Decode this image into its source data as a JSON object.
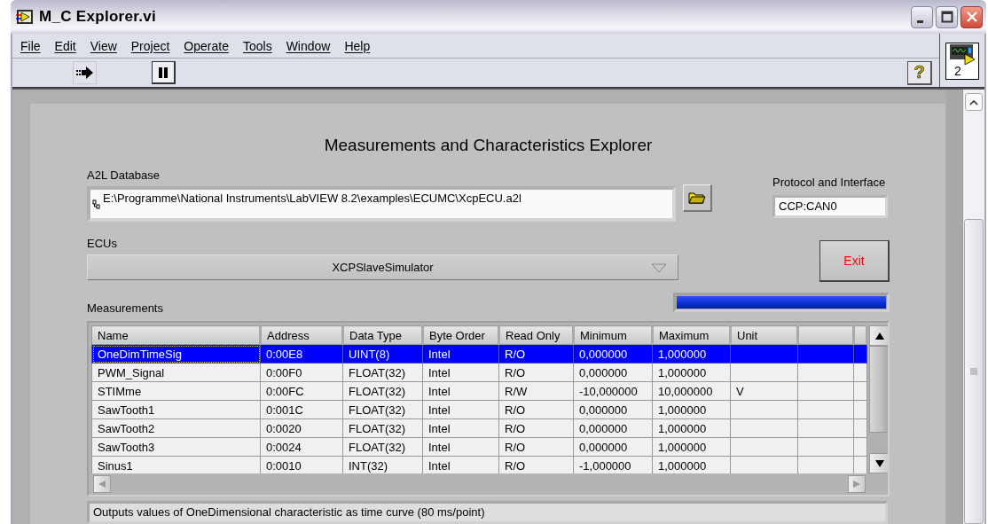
{
  "window": {
    "title": "M_C Explorer.vi"
  },
  "menu": [
    "File",
    "Edit",
    "View",
    "Project",
    "Operate",
    "Tools",
    "Window",
    "Help"
  ],
  "toolbar": {
    "help_button": "?",
    "vi_icon_label": "2"
  },
  "panel": {
    "title": "Measurements and Characteristics Explorer",
    "a2l_database": {
      "label": "A2L Database",
      "value": "E:\\Programme\\National Instruments\\LabVIEW 8.2\\examples\\ECUMC\\XcpECU.a2l"
    },
    "protocol": {
      "label": "Protocol and Interface",
      "value": "CCP:CAN0"
    },
    "ecus": {
      "label": "ECUs",
      "value": "XCPSlaveSimulator"
    },
    "exit_button": "Exit",
    "progress": {
      "level": 1
    },
    "measurements": {
      "label": "Measurements",
      "columns": [
        "Name",
        "Address",
        "Data Type",
        "Byte Order",
        "Read Only",
        "Minimum",
        "Maximum",
        "Unit"
      ],
      "rows": [
        {
          "selected": true,
          "cells": [
            "OneDimTimeSig",
            "0:00E8",
            "UINT(8)",
            "Intel",
            "R/O",
            "0,000000",
            "1,000000",
            ""
          ]
        },
        {
          "selected": false,
          "cells": [
            "PWM_Signal",
            "0:00F0",
            "FLOAT(32)",
            "Intel",
            "R/O",
            "0,000000",
            "1,000000",
            ""
          ]
        },
        {
          "selected": false,
          "cells": [
            "STIMme",
            "0:00FC",
            "FLOAT(32)",
            "Intel",
            "R/W",
            "-10,000000",
            "10,000000",
            "V"
          ]
        },
        {
          "selected": false,
          "cells": [
            "SawTooth1",
            "0:001C",
            "FLOAT(32)",
            "Intel",
            "R/O",
            "0,000000",
            "1,000000",
            ""
          ]
        },
        {
          "selected": false,
          "cells": [
            "SawTooth2",
            "0:0020",
            "FLOAT(32)",
            "Intel",
            "R/O",
            "0,000000",
            "1,000000",
            ""
          ]
        },
        {
          "selected": false,
          "cells": [
            "SawTooth3",
            "0:0024",
            "FLOAT(32)",
            "Intel",
            "R/O",
            "0,000000",
            "1,000000",
            ""
          ]
        },
        {
          "selected": false,
          "cells": [
            "Sinus1",
            "0:0010",
            "INT(32)",
            "Intel",
            "R/O",
            "-1,000000",
            "1,000000",
            ""
          ]
        }
      ]
    },
    "description": "Outputs values of OneDimensional characteristic as time curve (80 ms/point)"
  }
}
